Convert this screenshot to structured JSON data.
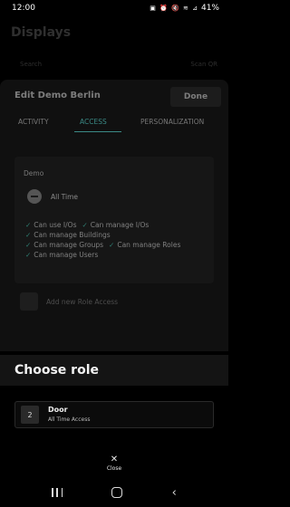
{
  "status_bar": {
    "time": "12:00",
    "icons": "▣ ⏰ 🔇 ≋ ⊿",
    "battery": "41%"
  },
  "background": {
    "title": "Displays",
    "search_placeholder": "Search",
    "scan_label": "Scan QR"
  },
  "edit_sheet": {
    "title": "Edit Demo Berlin",
    "done_label": "Done",
    "tabs": [
      "ACTIVITY",
      "ACCESS",
      "PERSONALIZATION"
    ],
    "active_tab": "ACCESS",
    "card": {
      "heading": "Demo",
      "role_label": "All Time",
      "permissions": [
        "Can use I/Os",
        "Can manage I/Os",
        "Can manage Buildings",
        "Can manage Groups",
        "Can manage Roles",
        "Can manage Users"
      ]
    },
    "add_role_label": "Add new Role Access"
  },
  "choose_role": {
    "title": "Choose role",
    "items": [
      {
        "badge": "2",
        "name": "Door",
        "subtitle": "All Time Access"
      }
    ],
    "close_label": "Close"
  },
  "colors": {
    "accent": "#3b8a86",
    "check": "#2f7f73"
  }
}
